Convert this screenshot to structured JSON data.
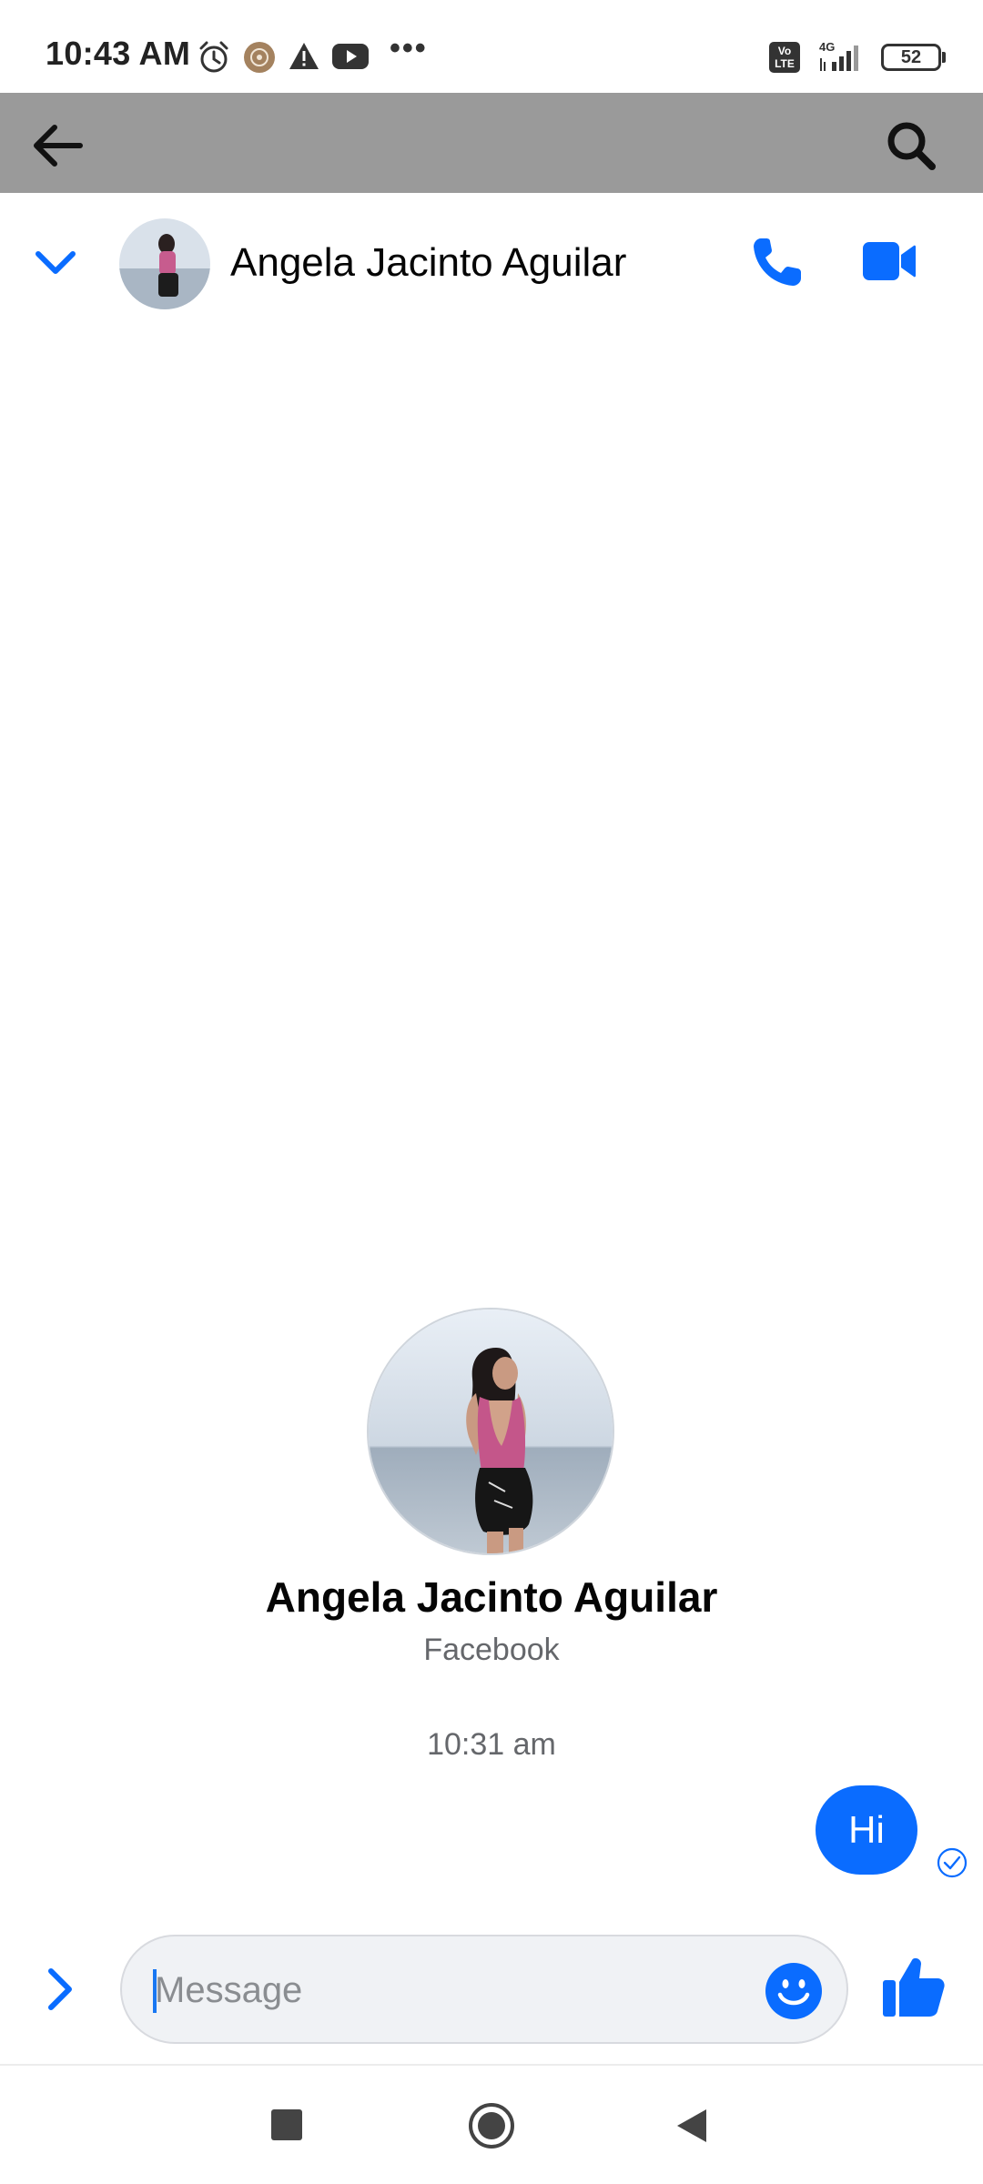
{
  "status_bar": {
    "time": "10:43 AM",
    "network": "4G",
    "volte": "Vo LTE",
    "battery": "52",
    "more": "•••",
    "icons": [
      "alarm-icon",
      "app-badge-icon",
      "warning-icon",
      "youtube-icon",
      "more-dots-icon",
      "volte-icon",
      "signal-icon",
      "battery-icon"
    ]
  },
  "toolbar": {
    "back_icon": "arrow-left-icon",
    "search_icon": "search-icon"
  },
  "chat_header": {
    "contact_name": "Angela Jacinto Aguilar",
    "icons": [
      "chevron-down-icon",
      "phone-icon",
      "video-camera-icon"
    ]
  },
  "profile": {
    "name": "Angela Jacinto Aguilar",
    "source": "Facebook"
  },
  "conversation": {
    "timestamp": "10:31 am",
    "messages": [
      {
        "text": "Hi",
        "from": "me",
        "status": "sent"
      }
    ]
  },
  "composer": {
    "placeholder": "Message",
    "value": "",
    "icons": [
      "chevron-right-icon",
      "emoji-icon",
      "thumbs-up-icon"
    ]
  },
  "nav_bar": {
    "icons": [
      "recents-square-icon",
      "home-circle-icon",
      "back-triangle-icon"
    ]
  },
  "colors": {
    "accent": "#0a6cff",
    "toolbar_bg": "#9a9a9a",
    "secondary_text": "#65676b",
    "input_bg": "#f0f2f5"
  }
}
